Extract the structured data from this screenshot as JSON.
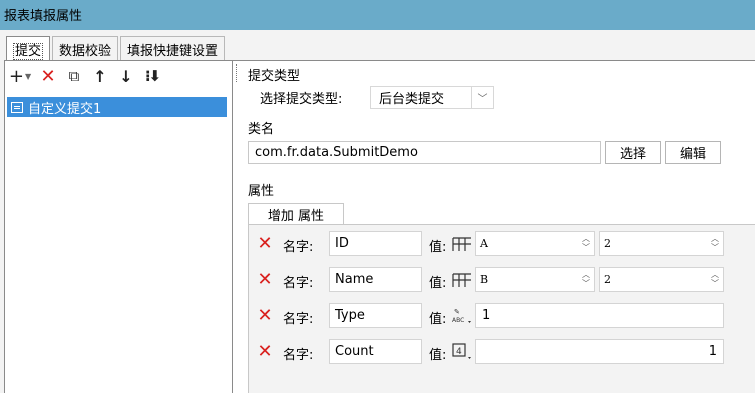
{
  "window": {
    "title": "报表填报属性"
  },
  "tabs": [
    {
      "label": "提交",
      "active": true
    },
    {
      "label": "数据校验",
      "active": false
    },
    {
      "label": "填报快捷键设置",
      "active": false
    }
  ],
  "toolbar": {
    "icons": [
      "add-icon",
      "delete-icon",
      "copy-icon",
      "move-up-icon",
      "move-down-icon",
      "sort-icon"
    ]
  },
  "submit_list": {
    "items": [
      {
        "label": "自定义提交1",
        "selected": true
      }
    ]
  },
  "submit_type": {
    "section_title": "提交类型",
    "select_label": "选择提交类型:",
    "selected_value": "后台类提交"
  },
  "class_name": {
    "section_title": "类名",
    "value": "com.fr.data.SubmitDemo",
    "choose_label": "选择",
    "edit_label": "编辑"
  },
  "properties": {
    "section_title": "属性",
    "add_label": "增加 属性",
    "name_label": "名字:",
    "value_label": "值:",
    "rows": [
      {
        "name": "ID",
        "value_type": "cell",
        "cell": "A",
        "value": "2"
      },
      {
        "name": "Name",
        "value_type": "cell",
        "cell": "B",
        "value": "2"
      },
      {
        "name": "Type",
        "value_type": "string",
        "value": "1"
      },
      {
        "name": "Count",
        "value_type": "number",
        "value": "1"
      }
    ]
  },
  "colors": {
    "titlebar": "#6aabc9",
    "selection": "#3b8fdb",
    "delete": "#d9201e"
  }
}
